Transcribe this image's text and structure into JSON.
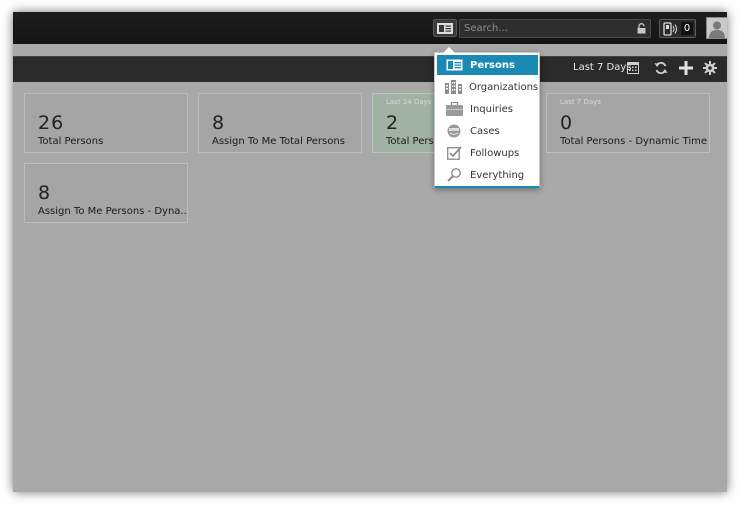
{
  "header": {
    "search_placeholder": "Search...",
    "notifications_count": "0"
  },
  "toolbar": {
    "range_label": "Last 7 Days"
  },
  "tiles": [
    {
      "period": "",
      "value": "26",
      "label": "Total Persons",
      "highlight": false
    },
    {
      "period": "",
      "value": "8",
      "label": "Assign To Me Total Persons",
      "highlight": false
    },
    {
      "period": "Last 14 Days",
      "value": "2",
      "label": "Total Persons",
      "highlight": true
    },
    {
      "period": "Last 7 Days",
      "value": "0",
      "label": "Total Persons - Dynamic Time",
      "highlight": false
    },
    {
      "period": "",
      "value": "8",
      "label": "Assign To Me Persons - Dyna...",
      "highlight": false
    }
  ],
  "search_menu": {
    "items": [
      {
        "label": "Persons",
        "icon": "person-card-icon",
        "active": true
      },
      {
        "label": "Organizations",
        "icon": "buildings-icon",
        "active": false
      },
      {
        "label": "Inquiries",
        "icon": "briefcase-icon",
        "active": false
      },
      {
        "label": "Cases",
        "icon": "case-icon",
        "active": false
      },
      {
        "label": "Followups",
        "icon": "checkbox-icon",
        "active": false
      },
      {
        "label": "Everything",
        "icon": "magnifier-icon",
        "active": false
      }
    ]
  },
  "colors": {
    "accent": "#1a8ab4",
    "topbar": "#1a1a1a",
    "toolbar": "#2a2a2a",
    "canvas": "#a9a9a9",
    "tile_green": "#a1b1a3"
  }
}
